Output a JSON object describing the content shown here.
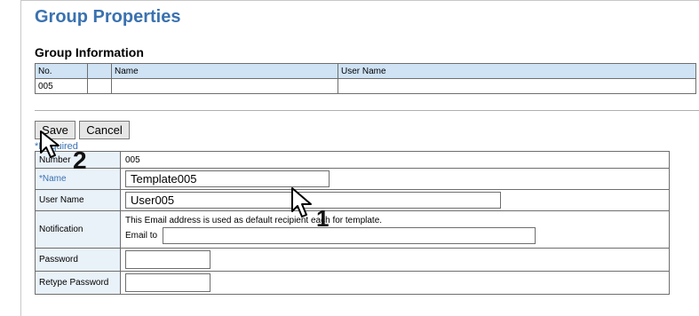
{
  "page_title": "Group Properties",
  "group_info": {
    "title": "Group Information",
    "headers": [
      "No.",
      "",
      "Name",
      "User Name"
    ],
    "row": [
      "005",
      "",
      "",
      ""
    ]
  },
  "buttons": {
    "save": "Save",
    "cancel": "Cancel"
  },
  "required_note": "*Required",
  "properties": {
    "number_label": "Number",
    "number_value": "005",
    "name_label": "*Name",
    "name_value": "Template005",
    "user_name_label": "User Name",
    "user_name_value": "User005",
    "notification_label": "Notification",
    "notification_text": "This Email address is used as default recipient each for template.",
    "email_to_label": "Email to",
    "email_to_value": "",
    "password_label": "Password",
    "password_value": "",
    "retype_label": "Retype Password",
    "retype_value": ""
  },
  "step_badges": [
    "2",
    "1"
  ],
  "icons": [
    "pointer-cursor-icon"
  ]
}
